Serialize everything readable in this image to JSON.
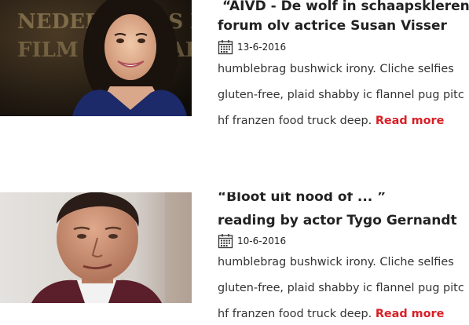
{
  "articles": [
    {
      "title_line1": "“AIVD - De wolf in schaapskleren”",
      "title_line2": "forum olv actrice Susan Visser",
      "date": "13-6-2016",
      "image_text": "NEDERLANDS FILM FESTIVAL",
      "excerpt_line1": "humblebrag bushwick irony. Cliche selfies",
      "excerpt_line2": "gluten-free, plaid shabby ic flannel pug pitc",
      "excerpt_line3": "hf franzen food truck deep.",
      "read_more": "Read more"
    },
    {
      "title_line1": "“Bloot uit nood of ... ”",
      "title_line2": "reading by actor  Tygo Gernandt",
      "date": "10-6-2016",
      "excerpt_line1": "humblebrag bushwick irony. Cliche selfies",
      "excerpt_line2": "gluten-free, plaid shabby ic flannel pug pitc",
      "excerpt_line3": "hf franzen food truck deep.",
      "read_more": "Read more"
    }
  ],
  "colors": {
    "read_more": "#d81f26",
    "title": "#222222",
    "text": "#333333"
  },
  "icons": {
    "date": "calendar-icon"
  }
}
